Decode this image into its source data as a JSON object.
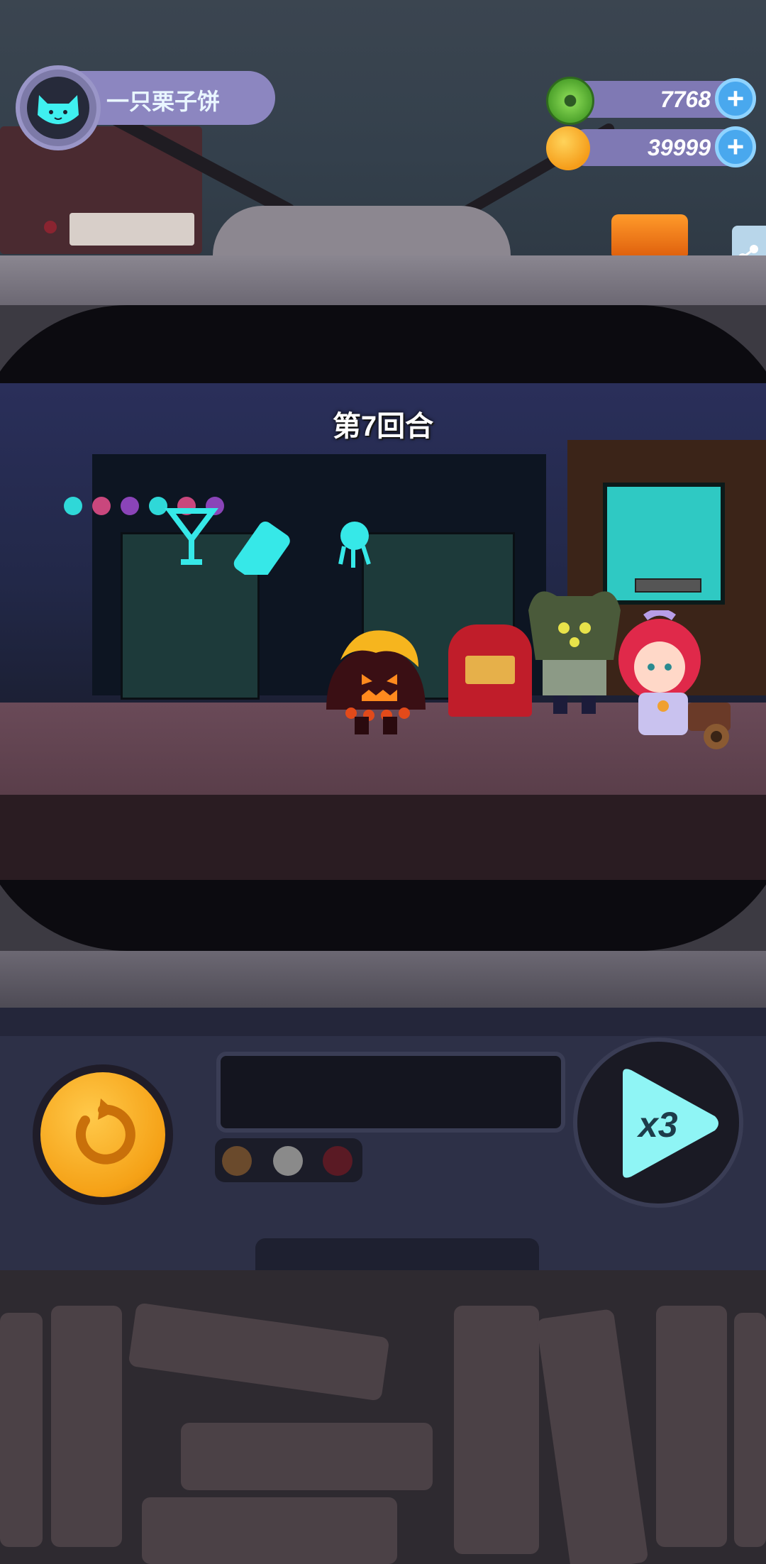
{
  "player": {
    "name": "一只栗子饼"
  },
  "currencies": [
    {
      "id": "donut",
      "value": "7768",
      "icon": "green-donut-icon",
      "color": "#6fc64a"
    },
    {
      "id": "planet-coin",
      "value": "39999",
      "icon": "orange-planet-coin-icon",
      "color": "#f6a623"
    }
  ],
  "plus_symbol": "+",
  "battle": {
    "round_text": "第7回合"
  },
  "controls": {
    "retry_icon": "retry-icon",
    "speed_label": "x3",
    "lights": [
      "#6a4a2c",
      "#8a8a8a",
      "#5a1a24"
    ]
  },
  "colors": {
    "accent_blue": "#49a8ee",
    "pill_purple": "#8c86c0",
    "neon_cyan": "#36e8e8"
  }
}
